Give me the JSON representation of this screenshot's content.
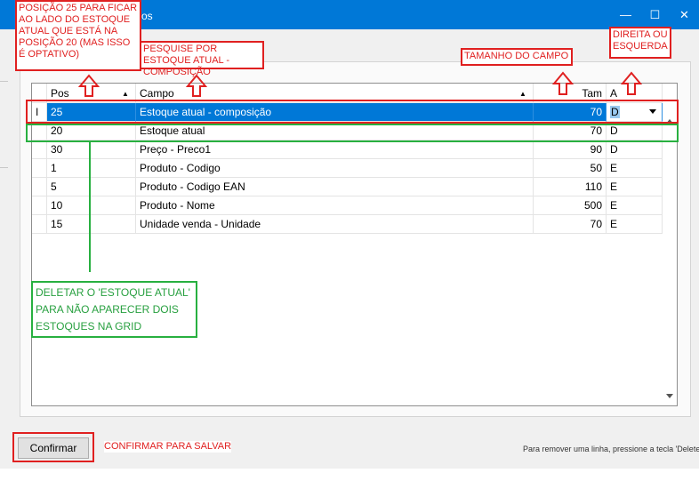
{
  "window": {
    "title_fragment": "os",
    "minimize_glyph": "—",
    "maximize_glyph": "☐",
    "close_glyph": "✕"
  },
  "grid": {
    "columns": [
      {
        "label": "Pos",
        "sorted": true
      },
      {
        "label": "Campo",
        "sorted": true
      },
      {
        "label": "Tam",
        "sorted": false
      },
      {
        "label": "A",
        "sorted": false
      }
    ],
    "selected_row": {
      "pos": "25",
      "campo": "Estoque atual - composição",
      "tam": "70",
      "a": "D"
    },
    "rows": [
      {
        "pos": "20",
        "campo": "Estoque atual",
        "tam": "70",
        "a": "D"
      },
      {
        "pos": "30",
        "campo": "Preço - Preco1",
        "tam": "90",
        "a": "D"
      },
      {
        "pos": "1",
        "campo": "Produto - Codigo",
        "tam": "50",
        "a": "E"
      },
      {
        "pos": "5",
        "campo": "Produto - Codigo EAN",
        "tam": "110",
        "a": "E"
      },
      {
        "pos": "10",
        "campo": "Produto - Nome",
        "tam": "500",
        "a": "E"
      },
      {
        "pos": "15",
        "campo": "Unidade venda - Unidade",
        "tam": "70",
        "a": "E"
      }
    ],
    "row_cursor_glyph": "I"
  },
  "footer": {
    "confirm_label": "Confirmar",
    "hint": "Para remover uma linha, pressione a tecla 'Delete'"
  },
  "annotations": {
    "pos25_note": "POSIÇÃO 25 PARA FICAR AO LADO DO ESTOQUE ATUAL QUE ESTÁ NA POSIÇÃO 20 (MAS ISSO É OPTATIVO)",
    "search_note": "PESQUISE POR ESTOQUE ATUAL - COMPOSIÇÃO",
    "size_note": "TAMANHO DO CAMPO",
    "align_note": "DIREITA OU ESQUERDA",
    "delete_note": "DELETAR O 'ESTOQUE ATUAL' PARA NÃO APARECER DOIS ESTOQUES NA GRID",
    "confirm_note": "CONFIRMAR PARA SALVAR",
    "arrow_color": "#e02020",
    "green_color": "#28b040"
  }
}
